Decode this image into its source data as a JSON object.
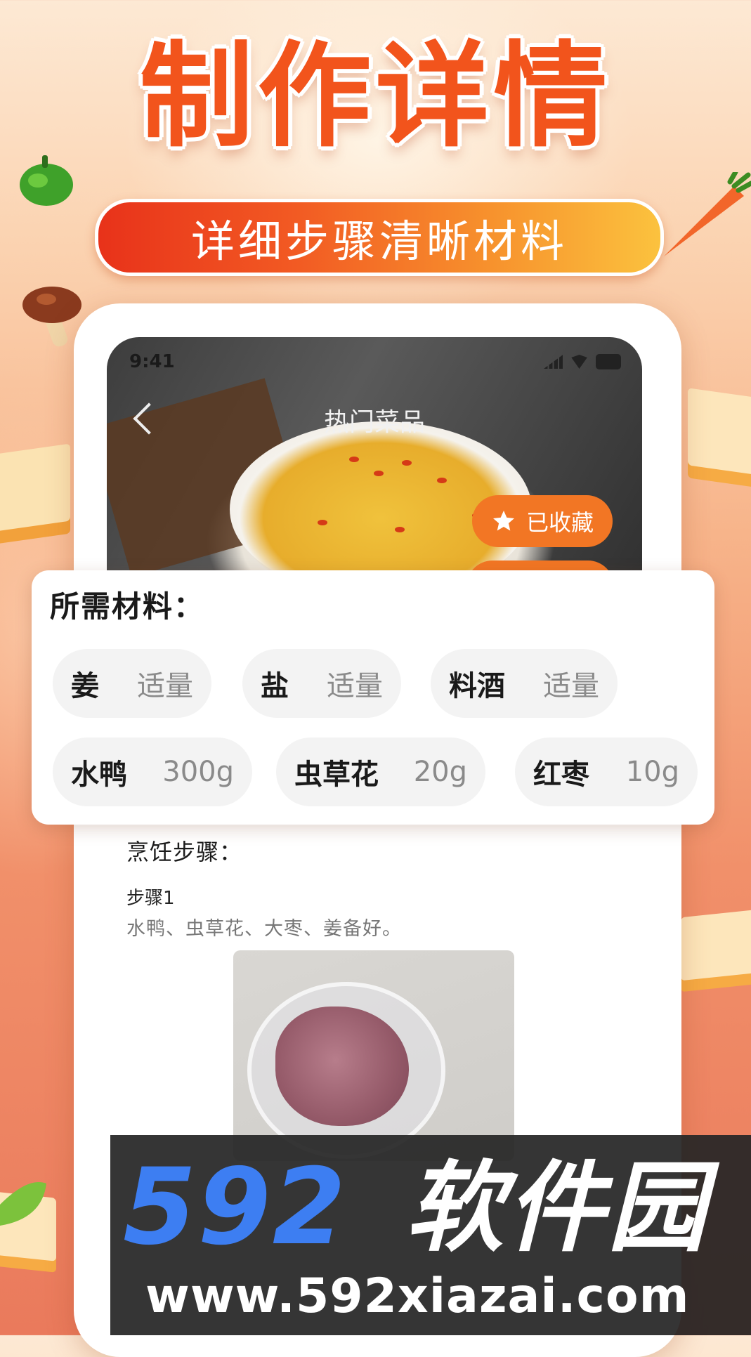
{
  "banner": {
    "headline": "制作详情",
    "subtitle": "详细步骤清晰材料"
  },
  "status_bar": {
    "time": "9:41"
  },
  "nav": {
    "title": "热门菜品"
  },
  "favorite": {
    "label": "已收藏"
  },
  "materials": {
    "title": "所需材料：",
    "items": [
      {
        "name": "姜",
        "qty": "适量"
      },
      {
        "name": "盐",
        "qty": "适量"
      },
      {
        "name": "料酒",
        "qty": "适量"
      },
      {
        "name": "水鸭",
        "qty": "300g"
      },
      {
        "name": "虫草花",
        "qty": "20g"
      },
      {
        "name": "红枣",
        "qty": "10g"
      }
    ]
  },
  "steps": {
    "title": "烹饪步骤：",
    "items": [
      {
        "label": "步骤1",
        "text": "水鸭、虫草花、大枣、姜备好。"
      }
    ]
  },
  "watermark": {
    "number": "592",
    "name": "软件园",
    "url": "www.592xiazai.com"
  },
  "colors": {
    "accent_orange": "#f27624",
    "headline_red": "#f2541c",
    "watermark_blue": "#3d7ef2"
  },
  "icons": [
    "back-chevron-icon",
    "star-icon",
    "signal-icon",
    "wifi-icon",
    "battery-icon"
  ]
}
